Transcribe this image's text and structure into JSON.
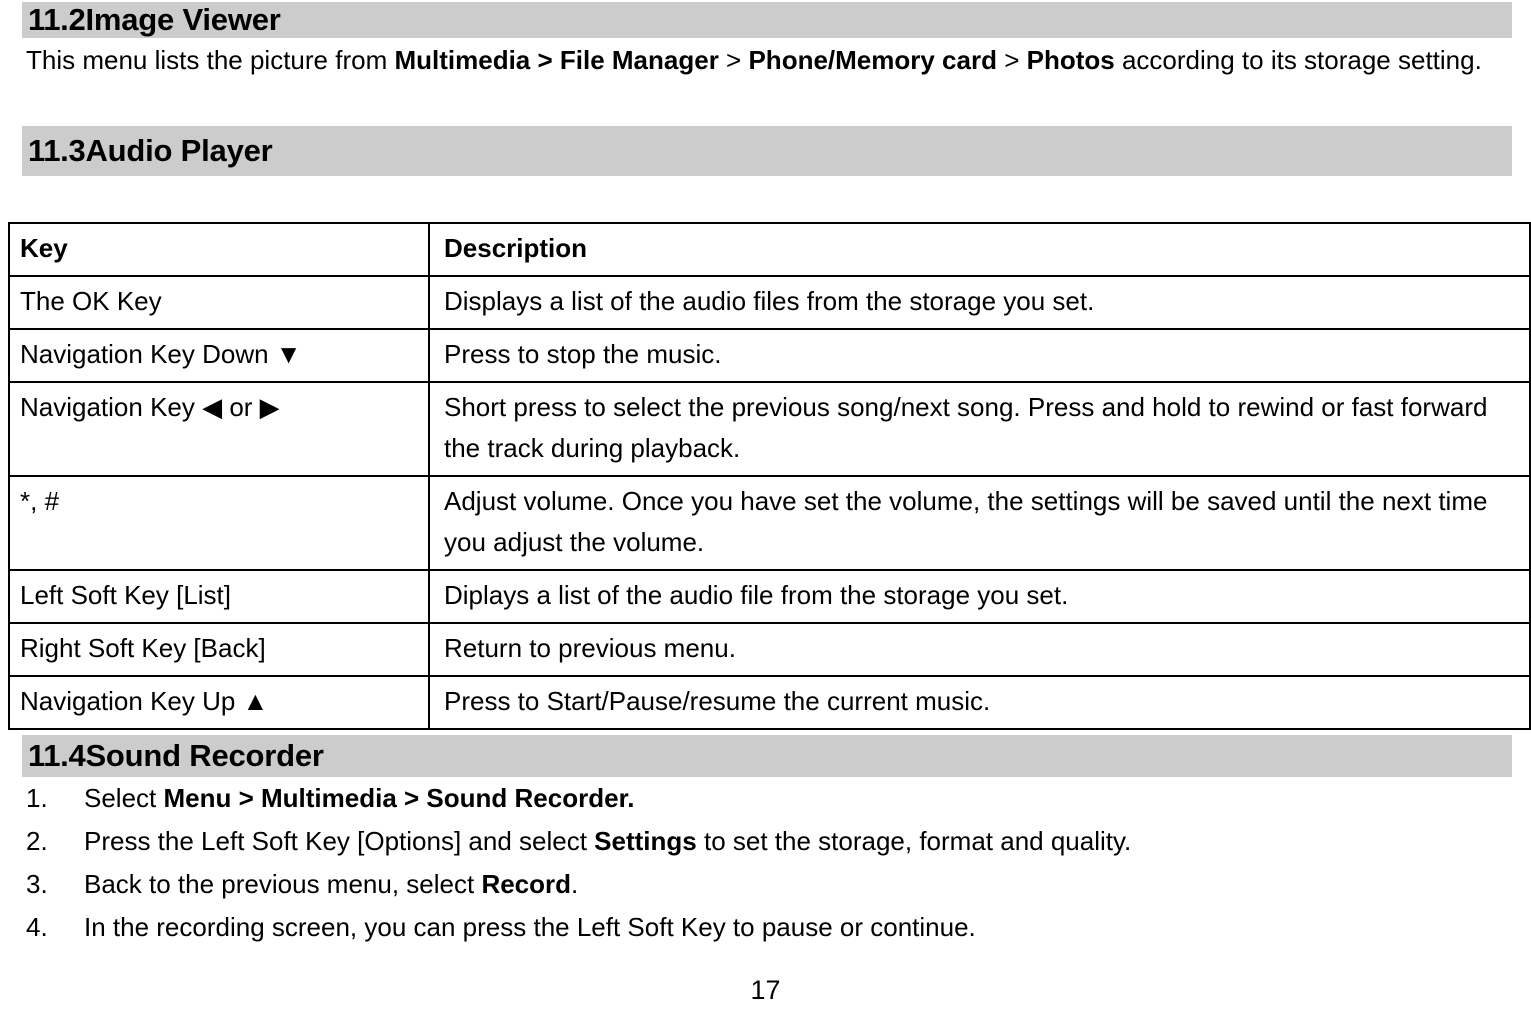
{
  "document": {
    "page_number": "17",
    "band_color": "#cccccc",
    "text_color": "#000000",
    "background": "#ffffff"
  },
  "sections": {
    "image_viewer": {
      "number": "11.2",
      "title": "Image Viewer",
      "paragraph": {
        "part1": "This menu lists the picture from ",
        "bold1": "Multimedia > File Manager",
        "part2": " > ",
        "bold2": "Phone/Memory card",
        "part3": " > ",
        "bold3": "Photos",
        "part4": " according to its storage setting."
      }
    },
    "audio_player": {
      "number": "11.3",
      "title": "Audio Player"
    },
    "sound_recorder": {
      "number": "11.4",
      "title": "Sound Recorder"
    }
  },
  "key_table": {
    "headers": {
      "key": "Key",
      "description": "Description"
    },
    "rows": [
      {
        "key": "The OK Key",
        "description": "Displays a list of the audio files from the storage you set."
      },
      {
        "key": "Navigation Key Down ▼",
        "description": "Press to stop the music."
      },
      {
        "key": "Navigation Key  ◀  or  ▶",
        "description": "Short press to select the previous song/next song. Press and hold to rewind or fast forward the track during playback."
      },
      {
        "key": "*, #",
        "description": "Adjust volume. Once you have set the volume, the settings will be saved until the next time you adjust the volume."
      },
      {
        "key": "Left Soft Key [List]",
        "description": "Diplays a list of the audio file from the storage you set."
      },
      {
        "key": "Right Soft Key [Back]",
        "description": "Return to previous menu."
      },
      {
        "key": "Navigation Key Up ▲",
        "description": "Press to Start/Pause/resume the current music."
      }
    ]
  },
  "steps": [
    {
      "marker": "1.",
      "part1": "Select ",
      "bold1": "Menu > Multimedia > Sound Recorder.",
      "part2": ""
    },
    {
      "marker": "2.",
      "part1": "Press the Left Soft Key [Options] and select ",
      "bold1": "Settings",
      "part2": " to set the storage, format and quality."
    },
    {
      "marker": "3.",
      "part1": "Back to the previous menu, select ",
      "bold1": "Record",
      "part2": "."
    },
    {
      "marker": "4.",
      "part1": "In the recording screen, you can press the Left Soft Key to pause or continue.",
      "bold1": "",
      "part2": ""
    }
  ]
}
